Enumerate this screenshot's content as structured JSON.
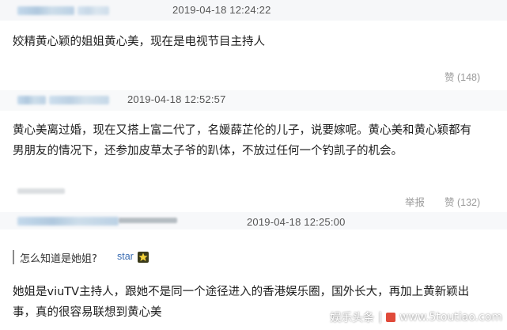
{
  "comments": [
    {
      "timestamp": "2019-04-18 12:24:22",
      "text": "姣精黄心颖的姐姐黄心美，现在是电视节目主持人",
      "like_label": "赞 (148)"
    },
    {
      "timestamp": "2019-04-18 12:52:57",
      "text_line1": "黄心美离过婚，现在又搭上富二代了，名媛薛芷伦的儿子，说要嫁呢。黄心美和黄心颖都有",
      "text_line2": "男朋友的情况下，还参加皮草太子爷的趴体，不放过任何一个钓凯子的机会。",
      "report_label": "举报",
      "like_label": "赞 (132)"
    },
    {
      "timestamp": "2019-04-18 12:25:00",
      "quote_text": "怎么知道是她姐?",
      "quote_user": "star",
      "text_line1": "她姐是viuTV主持人，跟她不是同一个途径进入的香港娱乐圈，国外长大，再加上黄新颖出",
      "text_line2": "事，真的很容易联想到黄心美"
    }
  ],
  "watermark": {
    "text1": "娱乐头条",
    "separator": "|",
    "text2": "www.5toutiao.com"
  },
  "colors": {
    "accent_link": "#3b6db3",
    "header_bg": "#f6f7f9",
    "muted": "#9a9a9a"
  }
}
